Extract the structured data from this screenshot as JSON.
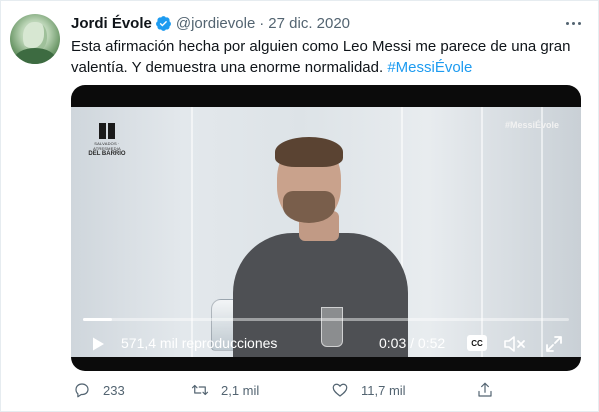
{
  "author": {
    "name": "Jordi Évole",
    "handle": "@jordievole",
    "separator": "·",
    "date": "27 dic. 2020",
    "verified": true
  },
  "tweet": {
    "line1": "Esta afirmación hecha por alguien como Leo Messi me parece de una gran",
    "line2": "valentía. Y demuestra una enorme normalidad. ",
    "hashtag": "#MessiÉvole"
  },
  "video": {
    "logo_small": "SALVADOS · ATRESMEDIA",
    "logo_big": "DEL BARRIO",
    "overlay_tag": "#MessiÉvole",
    "views": "571,4 mil reproducciones",
    "time": "0:03 / 0:52",
    "progress_fraction": 0.06,
    "cc_label": "CC"
  },
  "actions": {
    "replies": "233",
    "retweets": "2,1 mil",
    "likes": "11,7 mil"
  },
  "colors": {
    "link": "#1d9bf0",
    "secondary": "#536471",
    "verified": "#1d9bf0"
  },
  "icons": [
    "verified-badge-icon",
    "more-icon",
    "play-icon",
    "cc-icon",
    "mute-icon",
    "expand-icon",
    "reply-icon",
    "retweet-icon",
    "like-icon",
    "share-icon"
  ]
}
